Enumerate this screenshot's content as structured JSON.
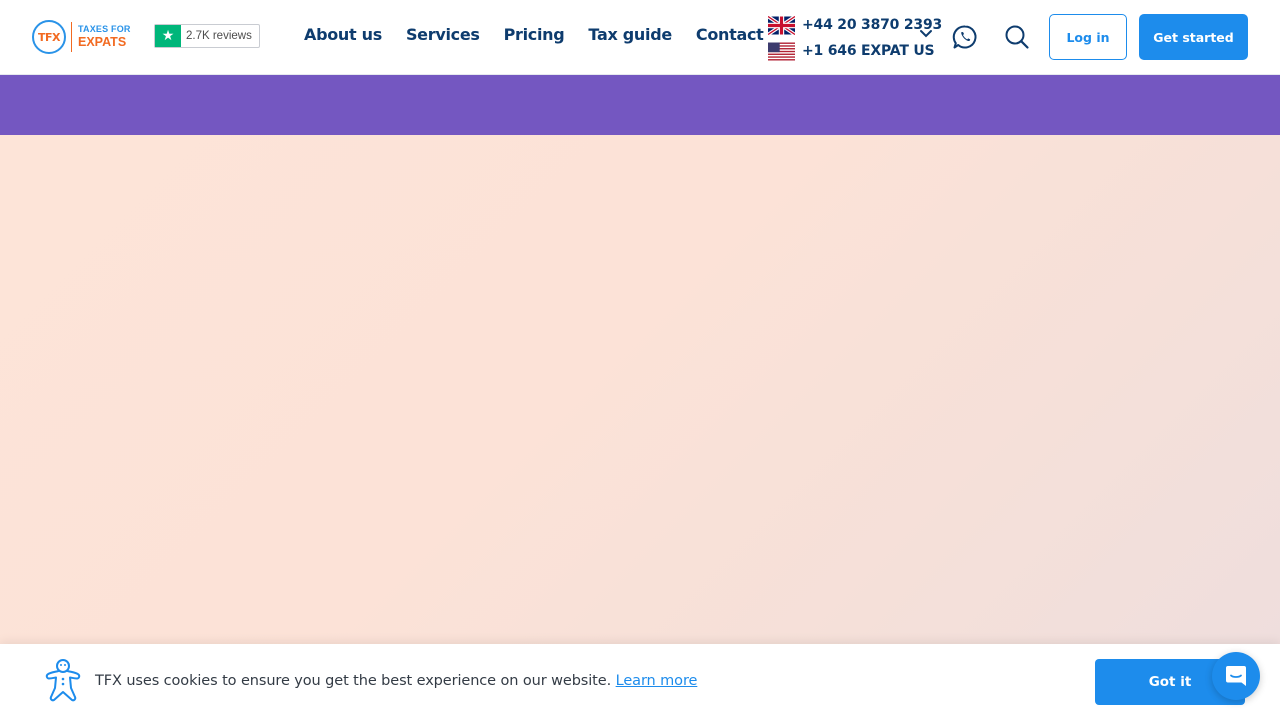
{
  "brand": {
    "logo_mark": "TFX",
    "logo_line1": "TAXES FOR",
    "logo_line2": "EXPATS",
    "primary_color": "#1d8cec",
    "orange_color": "#f26a21",
    "navy_color": "#0e3c6e"
  },
  "trustpilot": {
    "icon": "star-icon",
    "reviews_label": "2.7K reviews",
    "color": "#00b67a"
  },
  "nav": {
    "items": [
      {
        "label": "About us"
      },
      {
        "label": "Services"
      },
      {
        "label": "Pricing"
      },
      {
        "label": "Tax guide"
      },
      {
        "label": "Contact"
      }
    ]
  },
  "phones": [
    {
      "flag": "uk-flag-icon",
      "number": "+44 20 3870 2393"
    },
    {
      "flag": "us-flag-icon",
      "number": "+1 646 EXPAT US"
    }
  ],
  "header_actions": {
    "whatsapp_icon": "whatsapp-icon",
    "search_icon": "search-icon",
    "login_label": "Log in",
    "get_started_label": "Get started"
  },
  "band": {
    "color": "#7457c1"
  },
  "cookie_banner": {
    "icon": "gingerbread-cookie-icon",
    "text": "TFX uses cookies to ensure you get the best experience on our website.",
    "link_label": "Learn more",
    "button_label": "Got it"
  },
  "chat": {
    "icon": "chat-icon"
  }
}
